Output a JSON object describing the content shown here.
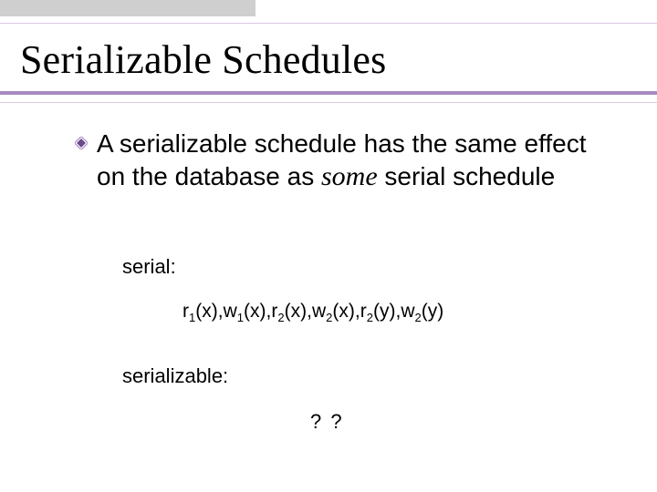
{
  "slide": {
    "title": "Serializable Schedules",
    "bullet": {
      "pre": "A serializable schedule has the same effect on the database as ",
      "em": "some",
      "post": " serial schedule"
    },
    "label_serial": "serial:",
    "formula_parts": {
      "r": "r",
      "w": "w",
      "s1": "1",
      "s2": "2",
      "x": "(x)",
      "y": "(y)",
      "sep": ","
    },
    "label_serializable": "serializable:",
    "qmark": "? ?"
  }
}
